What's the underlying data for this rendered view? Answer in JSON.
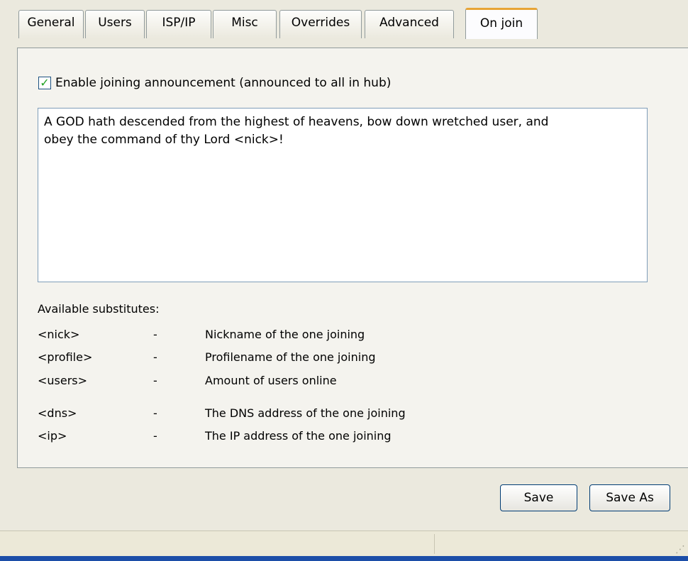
{
  "tabs": [
    {
      "label": "General"
    },
    {
      "label": "Users"
    },
    {
      "label": "ISP/IP"
    },
    {
      "label": "Misc"
    },
    {
      "label": "Overrides"
    },
    {
      "label": "Advanced"
    },
    {
      "label": "On join",
      "active": true
    }
  ],
  "announce": {
    "checkbox_label": "Enable joining announcement (announced to all in hub)",
    "checked": true,
    "check_glyph": "✓",
    "message": "A GOD hath descended from the highest of heavens, bow down wretched user, and\nobey the command of thy Lord <nick>!"
  },
  "substitutes": {
    "title": "Available substitutes:",
    "items": [
      {
        "code": "<nick>",
        "dash": "-",
        "desc": "Nickname of the one joining"
      },
      {
        "code": "<profile>",
        "dash": "-",
        "desc": "Profilename of the one joining"
      },
      {
        "code": "<users>",
        "dash": "-",
        "desc": "Amount of users online"
      },
      {
        "code": "<dns>",
        "dash": "-",
        "desc": "The DNS address of the one joining"
      },
      {
        "code": "<ip>",
        "dash": "-",
        "desc": "The IP address of the one joining"
      }
    ]
  },
  "buttons": {
    "save": "Save",
    "save_as": "Save As"
  },
  "status": {
    "grip": "⋰"
  }
}
